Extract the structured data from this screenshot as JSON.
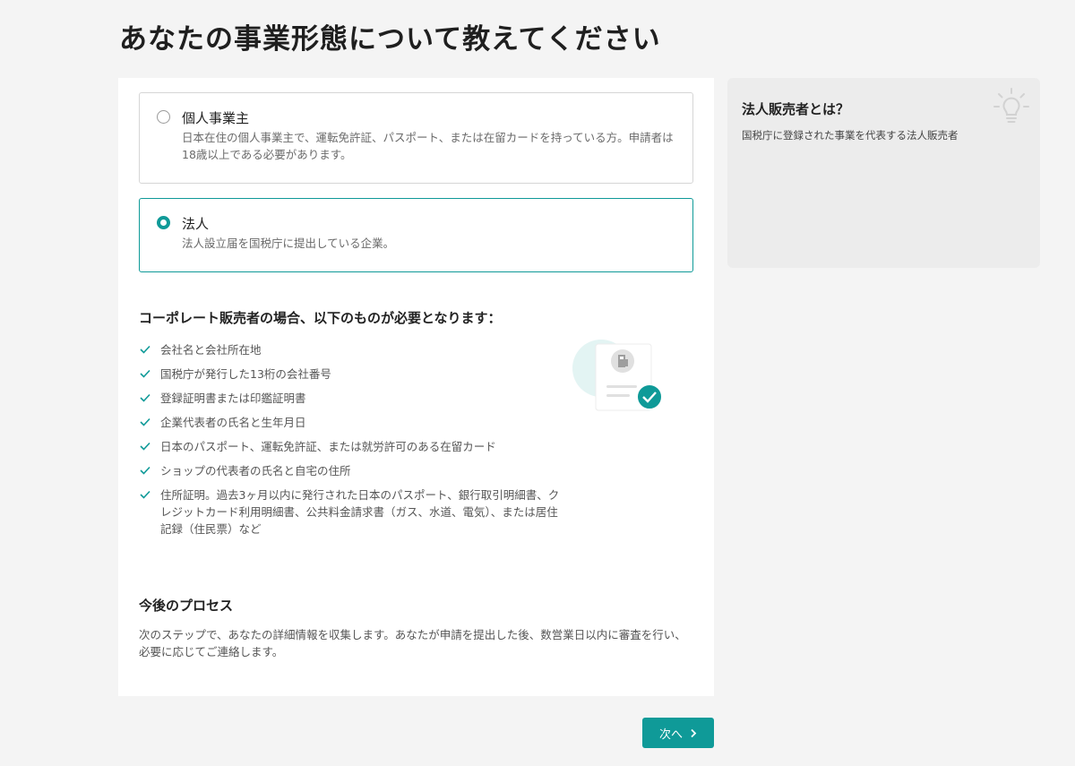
{
  "page": {
    "title": "あなたの事業形態について教えてください"
  },
  "business_types": [
    {
      "title": "個人事業主",
      "description": "日本在住の個人事業主で、運転免許証、パスポート、または在留カードを持っている方。申請者は18歳以上である必要があります。",
      "selected": false
    },
    {
      "title": "法人",
      "description": "法人設立届を国税庁に提出している企業。",
      "selected": true
    }
  ],
  "requirements": {
    "heading": "コーポレート販売者の場合、以下のものが必要となります：",
    "items": [
      "会社名と会社所在地",
      "国税庁が発行した13桁の会社番号",
      "登録証明書または印鑑証明書",
      "企業代表者の氏名と生年月日",
      "日本のパスポート、運転免許証、または就労許可のある在留カード",
      "ショップの代表者の氏名と自宅の住所",
      "住所証明。過去3ヶ月以内に発行された日本のパスポート、銀行取引明細書、クレジットカード利用明細書、公共料金請求書（ガス、水道、電気）、または居住記録（住民票）など"
    ]
  },
  "process": {
    "heading": "今後のプロセス",
    "description": "次のステップで、あなたの詳細情報を収集します。あなたが申請を提出した後、数営業日以内に審査を行い、必要に応じてご連絡します。"
  },
  "sidebar": {
    "title": "法人販売者とは？",
    "description": "国税庁に登録された事業を代表する法人販売者",
    "icon": "lightbulb-icon"
  },
  "footer": {
    "next_label": "次へ"
  },
  "colors": {
    "accent": "#0f9a98",
    "background": "#f4f4f4",
    "card": "#ffffff",
    "side_card": "#ececec"
  }
}
